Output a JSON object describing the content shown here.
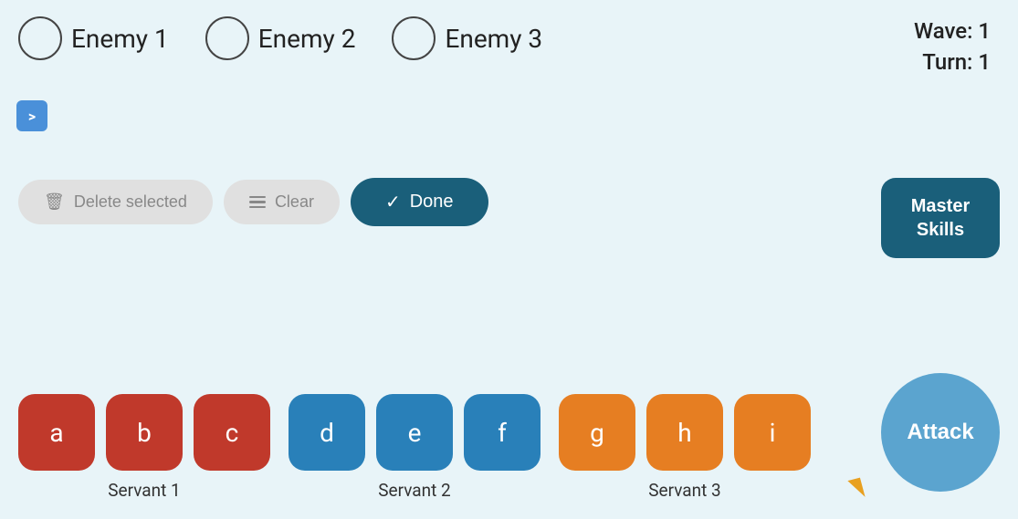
{
  "header": {
    "wave_label": "Wave: 1",
    "turn_label": "Turn: 1"
  },
  "enemies": [
    {
      "id": "enemy1",
      "label": "Enemy 1"
    },
    {
      "id": "enemy2",
      "label": "Enemy 2"
    },
    {
      "id": "enemy3",
      "label": "Enemy 3"
    }
  ],
  "arrow_btn": ">",
  "actions": {
    "delete_label": "Delete selected",
    "clear_label": "Clear",
    "done_label": "Done",
    "master_skills_label": "Master\nSkills"
  },
  "servants": [
    {
      "id": "servant1",
      "label": "Servant 1",
      "color": "red",
      "cards": [
        {
          "letter": "a"
        },
        {
          "letter": "b"
        },
        {
          "letter": "c"
        }
      ]
    },
    {
      "id": "servant2",
      "label": "Servant 2",
      "color": "blue",
      "cards": [
        {
          "letter": "d"
        },
        {
          "letter": "e"
        },
        {
          "letter": "f"
        }
      ]
    },
    {
      "id": "servant3",
      "label": "Servant 3",
      "color": "orange",
      "cards": [
        {
          "letter": "g"
        },
        {
          "letter": "h"
        },
        {
          "letter": "i"
        }
      ]
    }
  ],
  "attack_label": "Attack"
}
